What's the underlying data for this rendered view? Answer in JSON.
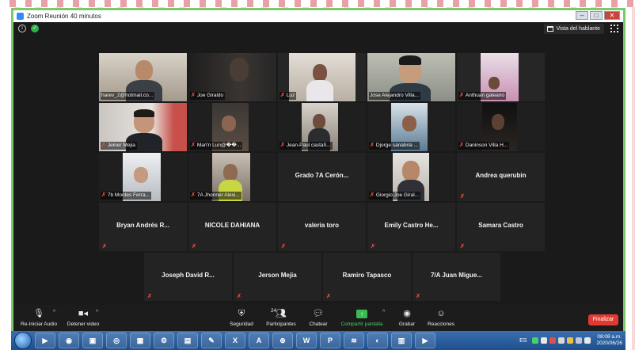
{
  "window": {
    "title": "Zoom Reunión 40 minutos"
  },
  "topbar": {
    "speaker_view_label": "Vista del hablante"
  },
  "participants": {
    "row1": [
      {
        "name": "harev_2@hotmail.co...",
        "muted": false,
        "video": true
      },
      {
        "name": "Joe Giraldo",
        "muted": true,
        "video": true
      },
      {
        "name": "Luz",
        "muted": true,
        "video": true
      },
      {
        "name": "Jose Alejandro Villa...",
        "muted": false,
        "video": true
      },
      {
        "name": "Anthuan galeano",
        "muted": true,
        "video": true
      }
    ],
    "row2": [
      {
        "name": "Jeiner Mejia",
        "muted": true,
        "video": true
      },
      {
        "name": "Mari'n Lun@��...",
        "muted": true,
        "video": true
      },
      {
        "name": "Jean-Paul castañ...",
        "muted": true,
        "video": true
      },
      {
        "name": "Djorge sanabria ...",
        "muted": true,
        "video": true
      },
      {
        "name": "Daninson Villa H...",
        "muted": true,
        "video": true
      }
    ],
    "row3": [
      {
        "name": "7b Montes Ferra...",
        "muted": true,
        "video": true
      },
      {
        "name": "7A Jhonner Alexi...",
        "muted": true,
        "video": true
      },
      {
        "name": "Grado 7A Cerón...",
        "muted": false,
        "video": false
      },
      {
        "name": "Giorgio Joe Giral...",
        "muted": true,
        "video": true
      },
      {
        "name": "Andrea querubin",
        "muted": true,
        "video": false
      }
    ],
    "row4": [
      {
        "name": "Bryan Andrés R...",
        "muted": true,
        "video": false
      },
      {
        "name": "NICOLE DAHIANA",
        "muted": true,
        "video": false
      },
      {
        "name": "valeria toro",
        "muted": true,
        "video": false
      },
      {
        "name": "Emily Castro He...",
        "muted": true,
        "video": false
      },
      {
        "name": "Samara Castro",
        "muted": true,
        "video": false
      }
    ],
    "row5": [
      {
        "name": "Joseph David R...",
        "muted": true,
        "video": false
      },
      {
        "name": "Jerson Mejia",
        "muted": true,
        "video": false
      },
      {
        "name": "Ramiro Tapasco",
        "muted": true,
        "video": false
      },
      {
        "name": "7/A Juan Migue...",
        "muted": true,
        "video": false
      }
    ]
  },
  "toolbar": {
    "audio_label": "Re-Iniciar Audio",
    "video_label": "Detener video",
    "security_label": "Seguridad",
    "participants_label": "Participantes",
    "participants_count": "24",
    "chat_label": "Chatear",
    "share_label": "Compartir pantalla",
    "record_label": "Grabar",
    "reactions_label": "Reacciones",
    "end_label": "Finalizar"
  },
  "taskbar": {
    "language": "ES",
    "time": "08:08 a.m.",
    "date": "2020/06/26"
  }
}
